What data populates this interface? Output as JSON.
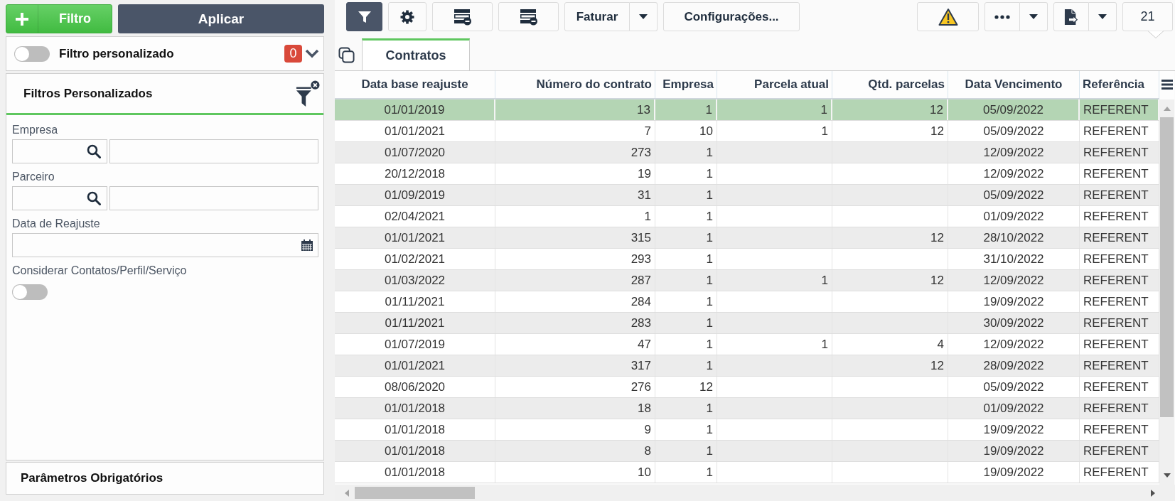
{
  "left_panel": {
    "actions": [
      {
        "kind": "add",
        "label": "Filtro"
      },
      {
        "kind": "apply",
        "label": "Aplicar"
      }
    ],
    "custom_filter": {
      "label": "Filtro personalizado",
      "on": false,
      "count": "0"
    },
    "filters": {
      "title": "Filtros Personalizados",
      "fields": [
        {
          "kind": "lookup",
          "label": "Empresa"
        },
        {
          "kind": "lookup",
          "label": "Parceiro"
        },
        {
          "kind": "date",
          "label": "Data de Reajuste"
        },
        {
          "kind": "toggle",
          "label": "Considerar Contatos/Perfil/Serviço",
          "on": false
        }
      ]
    },
    "required_params": {
      "title": "Parâmetros Obrigatórios"
    }
  },
  "toolbar": {
    "left": [
      {
        "kind": "filter",
        "pressed": true
      },
      {
        "kind": "settings"
      },
      {
        "kind": "rows_remove"
      },
      {
        "kind": "rows_remove"
      },
      {
        "kind": "split",
        "label": "Faturar"
      },
      {
        "kind": "text",
        "label": "Configurações..."
      }
    ],
    "right": [
      {
        "kind": "warning"
      },
      {
        "kind": "more"
      },
      {
        "kind": "export"
      },
      {
        "kind": "count",
        "label": "21"
      }
    ]
  },
  "tabs": [
    {
      "label": "Contratos",
      "selected": true
    }
  ],
  "table": {
    "columns": [
      {
        "label": "Data base reajuste"
      },
      {
        "label": "Número do contrato"
      },
      {
        "label": "Empresa"
      },
      {
        "label": "Parcela atual"
      },
      {
        "label": "Qtd. parcelas"
      },
      {
        "label": "Data Vencimento"
      },
      {
        "label": "Referência"
      }
    ],
    "rows": [
      {
        "selected": true,
        "cells": [
          "01/01/2019",
          "13",
          "1",
          "1",
          "12",
          "05/09/2022",
          "REFERENT"
        ]
      },
      {
        "selected": false,
        "cells": [
          "01/01/2021",
          "7",
          "10",
          "1",
          "12",
          "05/09/2022",
          "REFERENT"
        ]
      },
      {
        "selected": false,
        "cells": [
          "01/07/2020",
          "273",
          "1",
          null,
          null,
          "12/09/2022",
          "REFERENT"
        ]
      },
      {
        "selected": false,
        "cells": [
          "20/12/2018",
          "19",
          "1",
          null,
          null,
          "12/09/2022",
          "REFERENT"
        ]
      },
      {
        "selected": false,
        "cells": [
          "01/09/2019",
          "31",
          "1",
          null,
          null,
          "05/09/2022",
          "REFERENT"
        ]
      },
      {
        "selected": false,
        "cells": [
          "02/04/2021",
          "1",
          "1",
          null,
          null,
          "01/09/2022",
          "REFERENT"
        ]
      },
      {
        "selected": false,
        "cells": [
          "01/01/2021",
          "315",
          "1",
          null,
          "12",
          "28/10/2022",
          "REFERENT"
        ]
      },
      {
        "selected": false,
        "cells": [
          "01/02/2021",
          "293",
          "1",
          null,
          null,
          "31/10/2022",
          "REFERENT"
        ]
      },
      {
        "selected": false,
        "cells": [
          "01/03/2022",
          "287",
          "1",
          "1",
          "12",
          "12/09/2022",
          "REFERENT"
        ]
      },
      {
        "selected": false,
        "cells": [
          "01/11/2021",
          "284",
          "1",
          null,
          null,
          "19/09/2022",
          "REFERENT"
        ]
      },
      {
        "selected": false,
        "cells": [
          "01/11/2021",
          "283",
          "1",
          null,
          null,
          "30/09/2022",
          "REFERENT"
        ]
      },
      {
        "selected": false,
        "cells": [
          "01/07/2019",
          "47",
          "1",
          "1",
          "4",
          "12/09/2022",
          "REFERENT"
        ]
      },
      {
        "selected": false,
        "cells": [
          "01/01/2021",
          "317",
          "1",
          null,
          "12",
          "28/09/2022",
          "REFERENT"
        ]
      },
      {
        "selected": false,
        "cells": [
          "08/06/2020",
          "276",
          "12",
          null,
          null,
          "05/09/2022",
          "REFERENT"
        ]
      },
      {
        "selected": false,
        "cells": [
          "01/01/2018",
          "18",
          "1",
          null,
          null,
          "01/09/2022",
          "REFERENT"
        ]
      },
      {
        "selected": false,
        "cells": [
          "01/01/2018",
          "9",
          "1",
          null,
          null,
          "19/09/2022",
          "REFERENT"
        ]
      },
      {
        "selected": false,
        "cells": [
          "01/01/2018",
          "8",
          "1",
          null,
          null,
          "19/09/2022",
          "REFERENT"
        ]
      },
      {
        "selected": false,
        "cells": [
          "01/01/2018",
          "10",
          "1",
          null,
          null,
          "19/09/2022",
          "REFERENT"
        ]
      }
    ]
  }
}
